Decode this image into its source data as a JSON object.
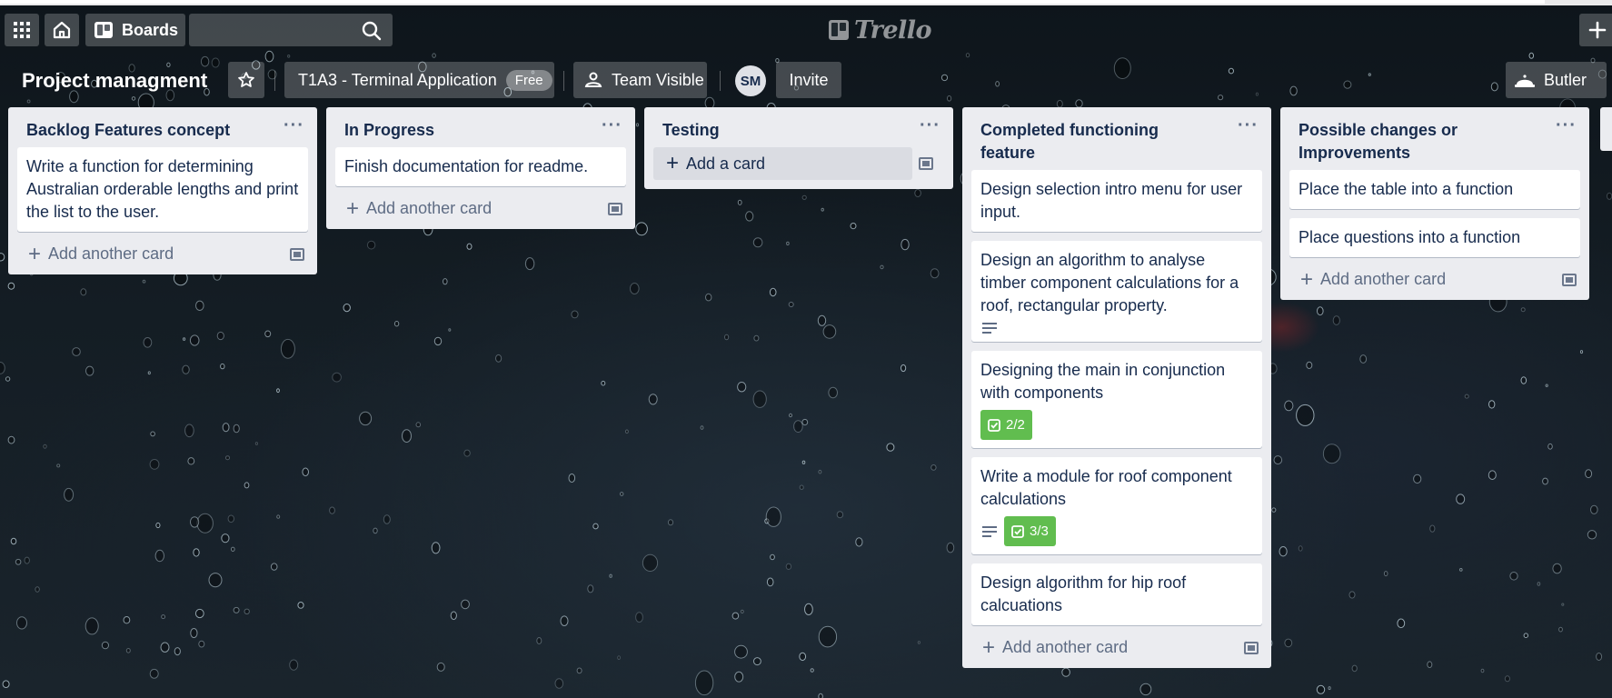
{
  "app": {
    "brand": "Trello",
    "boards_label": "Boards",
    "search_value": "",
    "colors": {
      "header_button": "rgba(255,255,255,0.22)",
      "list_bg": "#ebecf0",
      "checklist_done": "#61bd4f",
      "text": "#172b4d"
    }
  },
  "icons": [
    "apps-grid-icon",
    "home-icon",
    "boards-icon",
    "search-icon",
    "plus-icon",
    "star-icon",
    "team-icon",
    "butler-icon",
    "ellipsis-icon",
    "card-template-icon",
    "description-icon",
    "checklist-icon"
  ],
  "board": {
    "title": "Project managment",
    "team": "T1A3 - Terminal Application",
    "team_badge": "Free",
    "visibility": "Team Visible",
    "member_initials": "SM",
    "invite": "Invite",
    "butler": "Butler"
  },
  "lists": [
    {
      "title": "Backlog Features concept",
      "cards": [
        {
          "text": "Write a function for determining Australian orderable lengths and print the list to the user."
        }
      ],
      "add_label": "Add another card"
    },
    {
      "title": "In Progress",
      "cards": [
        {
          "text": "Finish documentation for readme."
        }
      ],
      "add_label": "Add another card"
    },
    {
      "title": "Testing",
      "cards": [],
      "add_label": "Add a card"
    },
    {
      "title": "Completed functioning feature",
      "cards": [
        {
          "text": "Design selection intro menu for user input."
        },
        {
          "text": "Design an algorithm to analyse timber component calculations for a roof, rectangular property.",
          "has_description": true
        },
        {
          "text": "Designing the main in conjunction with components",
          "checklist": "2/2"
        },
        {
          "text": "Write a module for roof component calculations",
          "has_description": true,
          "checklist": "3/3"
        },
        {
          "text": "Design algorithm for hip roof calcuations"
        }
      ],
      "add_label": "Add another card"
    },
    {
      "title": "Possible changes or Improvements",
      "cards": [
        {
          "text": "Place the table into a function"
        },
        {
          "text": "Place questions into a function"
        }
      ],
      "add_label": "Add another card"
    }
  ]
}
